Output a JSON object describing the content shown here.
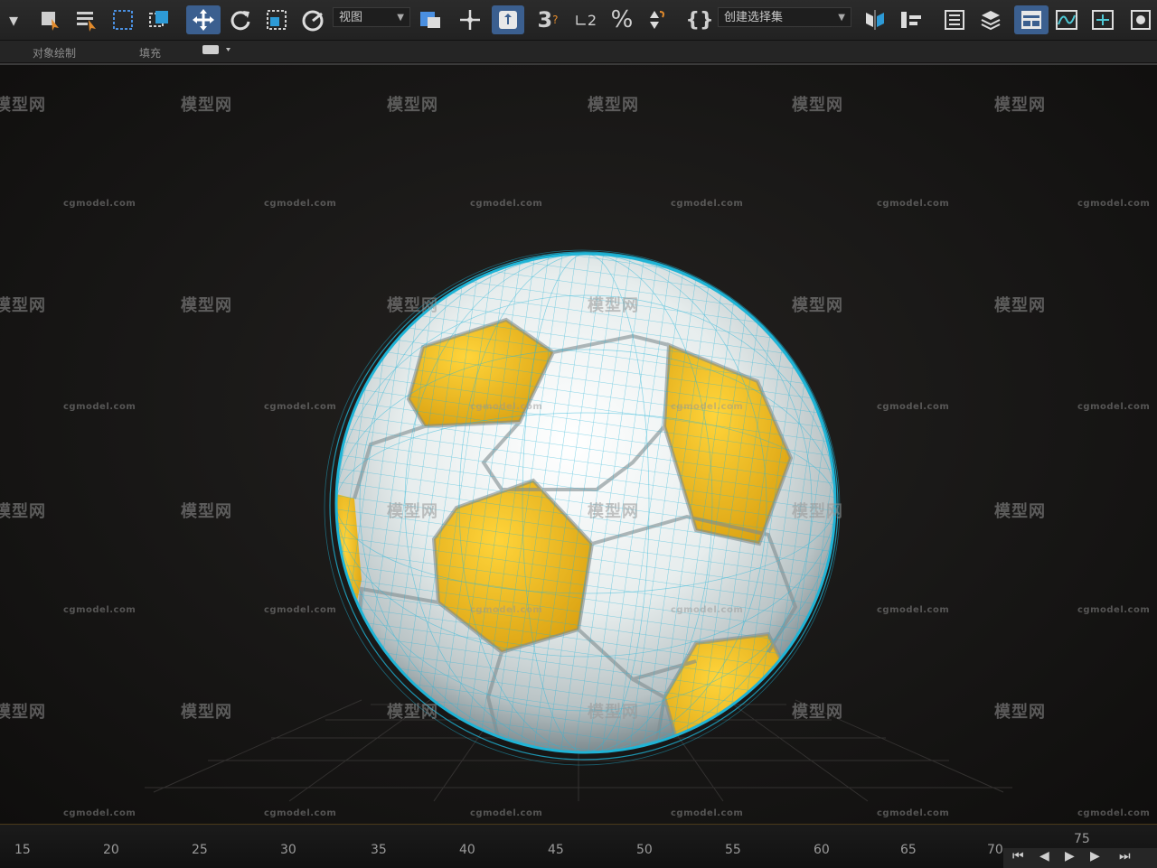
{
  "toolbar": {
    "view_dropdown": "视图",
    "selection_set_dropdown": "创建选择集",
    "snap_3d_label": "3",
    "angle_snap_label": "2",
    "percent_snap_label": "%"
  },
  "ribbon": {
    "tab_object_paint": "对象绘制",
    "tab_fill": "填充"
  },
  "watermark": {
    "cn": "模型网",
    "en": "cgmodel.com"
  },
  "timeline": {
    "ticks": [
      "15",
      "20",
      "25",
      "30",
      "35",
      "40",
      "45",
      "50",
      "55",
      "60",
      "65",
      "70",
      "75"
    ]
  },
  "colors": {
    "wire": "#1fb4d6",
    "panel_yellow": "#f2c019",
    "panel_white": "#eef1f1",
    "background": "#161514",
    "toolbar": "#262626",
    "active_tool": "#3b5f8f"
  }
}
